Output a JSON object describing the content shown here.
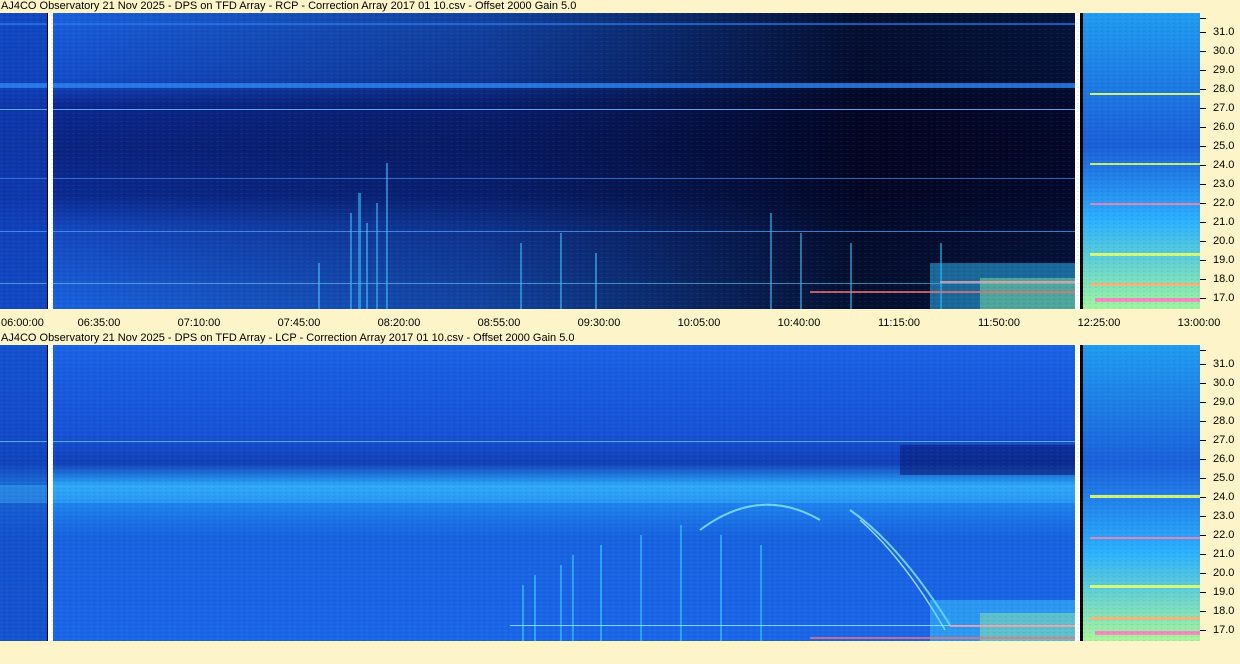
{
  "panels": [
    {
      "id": "rcp",
      "title": "AJ4CO Observatory 21 Nov 2025  -  DPS on TFD Array  -  RCP  -  Correction Array 2017 01 10.csv  -  Offset 2000  Gain 5.0",
      "time_labels": [
        "06:00:00",
        "06:35:00",
        "07:10:00",
        "07:45:00",
        "08:20:00",
        "08:55:00",
        "09:30:00",
        "10:05:00",
        "10:40:00",
        "11:15:00",
        "11:50:00",
        "12:25:00",
        "13:00:00"
      ]
    },
    {
      "id": "lcp",
      "title": "AJ4CO Observatory 21 Nov 2025  -  DPS on TFD Array  -  LCP  -  Correction Array 2017 01 10.csv  -  Offset 2000  Gain 5.0",
      "time_labels": []
    }
  ],
  "freq_labels": [
    "31.0",
    "30.0",
    "29.0",
    "28.0",
    "27.0",
    "26.0",
    "25.0",
    "24.0",
    "23.0",
    "22.0",
    "21.0",
    "20.0",
    "19.0",
    "18.0",
    "17.0"
  ],
  "colors": {
    "background": "#fdf5c9",
    "spectrogram_base": "#1560e0",
    "spectrogram_dark": "#040c3a",
    "burst": "#5fe8ff",
    "hot": "#e8ff70"
  }
}
